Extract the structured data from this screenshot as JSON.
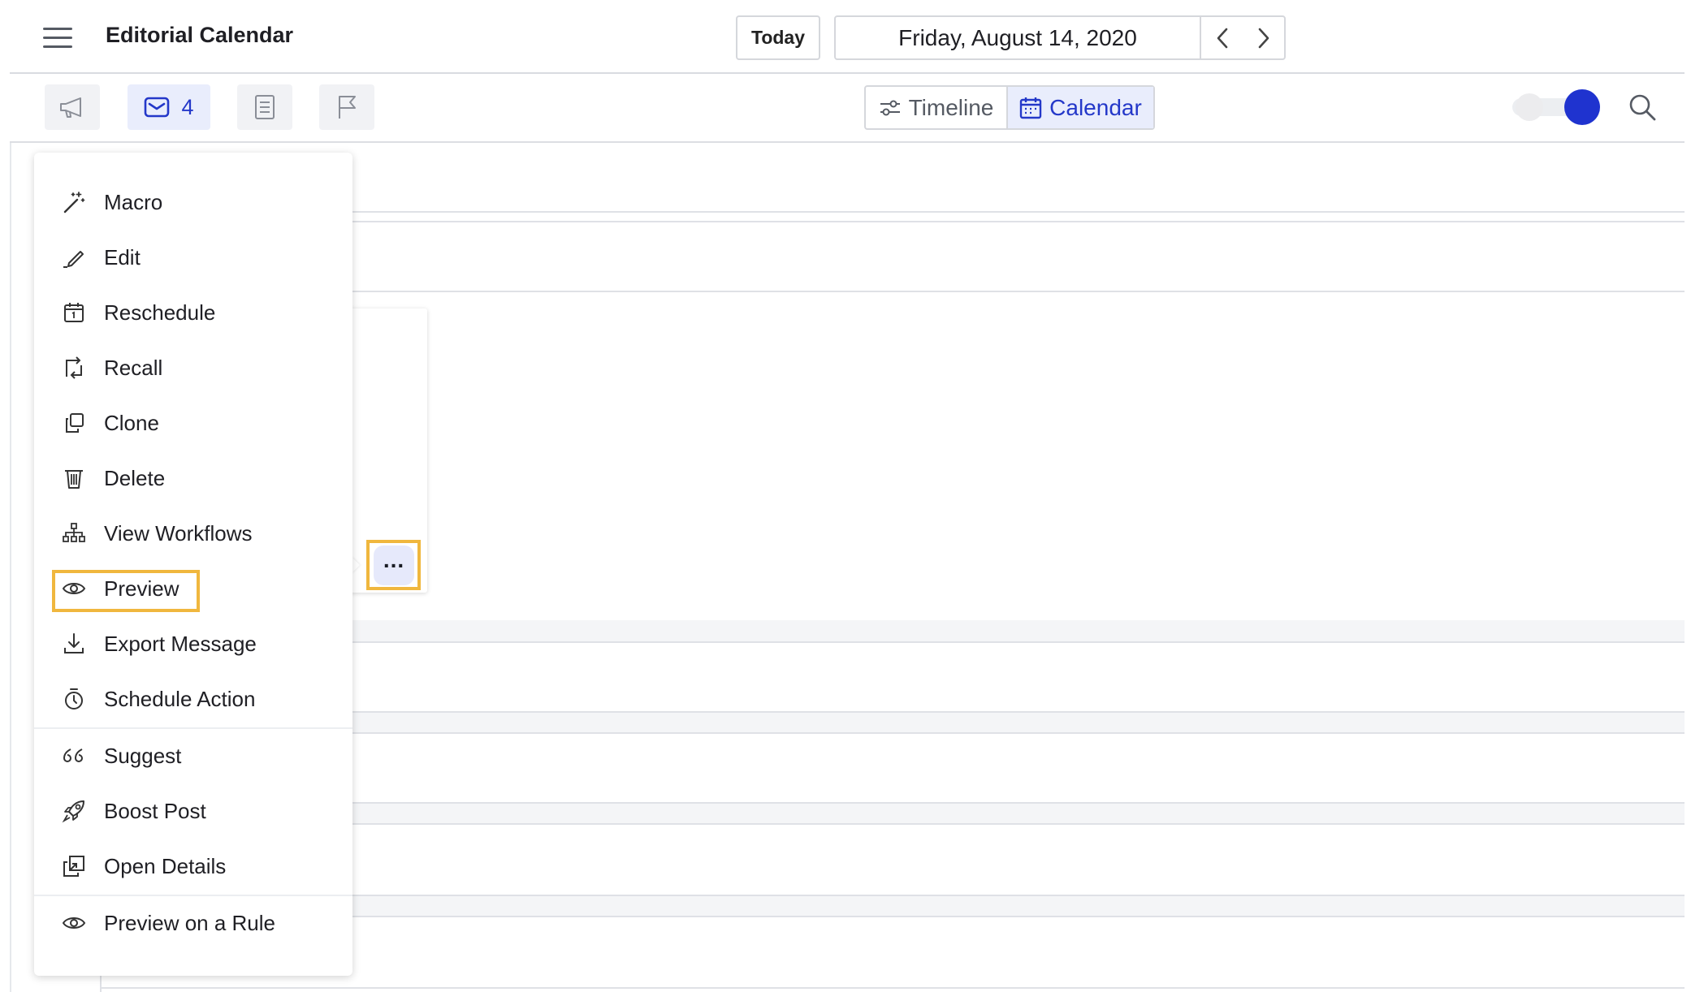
{
  "header": {
    "title": "Editorial Calendar",
    "today_label": "Today",
    "date": "Friday, August 14, 2020"
  },
  "toolbar": {
    "message_count": "4",
    "views": [
      {
        "label": "Timeline",
        "selected": false
      },
      {
        "label": "Calendar",
        "selected": true
      }
    ],
    "toggle_on": true
  },
  "menu": {
    "items": [
      {
        "label": "Macro",
        "icon": "magic-wand-icon"
      },
      {
        "label": "Edit",
        "icon": "pencil-icon"
      },
      {
        "label": "Reschedule",
        "icon": "calendar-icon"
      },
      {
        "label": "Recall",
        "icon": "recall-icon"
      },
      {
        "label": "Clone",
        "icon": "clone-icon"
      },
      {
        "label": "Delete",
        "icon": "trash-icon"
      },
      {
        "label": "View Workflows",
        "icon": "workflow-icon"
      },
      {
        "label": "Preview",
        "icon": "eye-icon",
        "highlighted": true
      },
      {
        "label": "Export Message",
        "icon": "download-icon"
      },
      {
        "label": "Schedule Action",
        "icon": "timer-icon"
      },
      {
        "label": "Suggest",
        "icon": "quote-icon"
      },
      {
        "label": "Boost Post",
        "icon": "rocket-icon"
      },
      {
        "label": "Open Details",
        "icon": "open-details-icon"
      },
      {
        "label": "Preview on a Rule",
        "icon": "eye-icon"
      }
    ]
  },
  "colors": {
    "accent": "#1f33cf",
    "highlight": "#f0b73e"
  }
}
